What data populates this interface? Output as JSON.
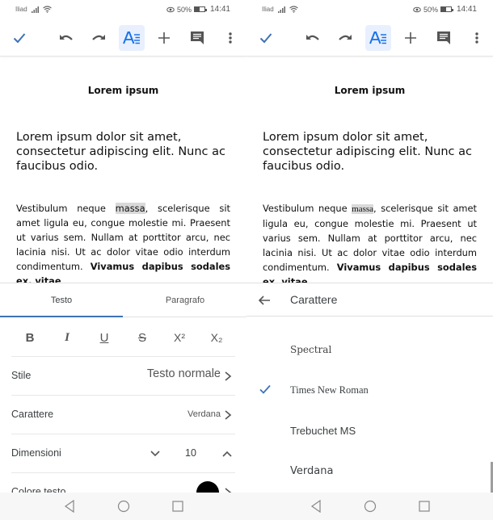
{
  "status_bar": {
    "carrier": "Iliad",
    "battery": "50%",
    "time": "14:41"
  },
  "toolbar": {
    "icons": [
      "check-icon",
      "undo-icon",
      "redo-icon",
      "text-format-icon",
      "add-icon",
      "comment-icon",
      "more-vert-icon"
    ],
    "accent": "#1a73e8"
  },
  "document": {
    "title": "Lorem ipsum",
    "paragraph1": "Lorem ipsum dolor sit amet, consectetur adipiscing elit. Nunc ac faucibus odio.",
    "paragraph2_before": "Vestibulum neque ",
    "paragraph2_highlight": "massa",
    "paragraph2_after": ", scelerisque sit amet ligula eu, congue molestie mi. Praesent ut varius sem. Nullam at porttitor arcu, nec lacinia nisi. Ut ac dolor vitae odio interdum condimentum. ",
    "paragraph2_bold": "Vivamus dapibus sodales ex, vitae"
  },
  "format_panel": {
    "tabs": [
      {
        "label": "Testo",
        "active": true
      },
      {
        "label": "Paragrafo",
        "active": false
      }
    ],
    "format_buttons": [
      {
        "label": "B",
        "name": "bold"
      },
      {
        "label": "I",
        "name": "italic"
      },
      {
        "label": "U",
        "name": "underline"
      },
      {
        "label": "S",
        "name": "strikethrough"
      },
      {
        "label": "X²",
        "name": "superscript"
      },
      {
        "label": "X₂",
        "name": "subscript"
      }
    ],
    "style": {
      "label": "Stile",
      "value": "Testo normale"
    },
    "font": {
      "label": "Carattere",
      "value": "Verdana"
    },
    "size": {
      "label": "Dimensioni",
      "value": "10"
    },
    "text_color": {
      "label": "Colore testo",
      "value": "#000000"
    }
  },
  "font_picker": {
    "title": "Carattere",
    "fonts": [
      {
        "label": "Spectral",
        "selected": false
      },
      {
        "label": "Times New Roman",
        "selected": true
      },
      {
        "label": "Trebuchet MS",
        "selected": false
      },
      {
        "label": "Verdana",
        "selected": false
      }
    ]
  },
  "nav_bar": {
    "buttons": [
      "back-icon",
      "home-icon",
      "recents-icon"
    ]
  }
}
